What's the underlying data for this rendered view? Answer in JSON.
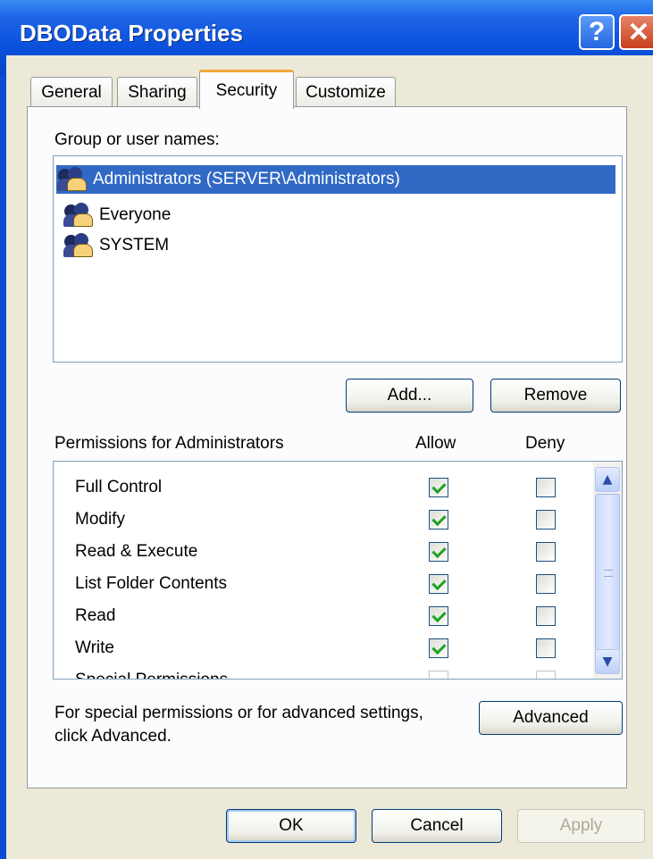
{
  "window": {
    "title": "DBOData Properties",
    "help_label": "?",
    "close_label": "✕"
  },
  "tabs": [
    {
      "label": "General"
    },
    {
      "label": "Sharing"
    },
    {
      "label": "Security"
    },
    {
      "label": "Customize"
    }
  ],
  "groups": {
    "label": "Group or user names:",
    "items": [
      {
        "name": "Administrators (SERVER\\Administrators)",
        "selected": true
      },
      {
        "name": "Everyone",
        "selected": false
      },
      {
        "name": "SYSTEM",
        "selected": false
      }
    ],
    "add_label": "Add...",
    "remove_label": "Remove"
  },
  "permissions": {
    "label": "Permissions for Administrators",
    "allow_label": "Allow",
    "deny_label": "Deny",
    "rows": [
      {
        "name": "Full Control",
        "allow": true,
        "deny": false
      },
      {
        "name": "Modify",
        "allow": true,
        "deny": false
      },
      {
        "name": "Read & Execute",
        "allow": true,
        "deny": false
      },
      {
        "name": "List Folder Contents",
        "allow": true,
        "deny": false
      },
      {
        "name": "Read",
        "allow": true,
        "deny": false
      },
      {
        "name": "Write",
        "allow": true,
        "deny": false
      },
      {
        "name": "Special Permissions",
        "allow": false,
        "deny": false
      }
    ]
  },
  "advanced": {
    "note_line1": "For special permissions or for advanced settings,",
    "note_line2": "click Advanced.",
    "button_label": "Advanced"
  },
  "footer": {
    "ok_label": "OK",
    "cancel_label": "Cancel",
    "apply_label": "Apply"
  },
  "colors": {
    "titlebar": "#0A52DD",
    "selection": "#316AC5",
    "check": "#21A121",
    "active_tab_accent": "#F1A93A"
  }
}
